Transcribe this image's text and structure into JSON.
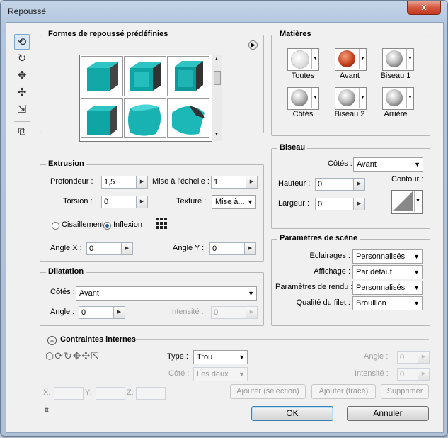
{
  "window": {
    "title": "Repoussé",
    "close_label": "x"
  },
  "tools": [
    "rotate-object-tool",
    "roll-object-tool",
    "drag-object-tool",
    "slide-object-tool",
    "scale-object-tool",
    "camera-icon"
  ],
  "presets": {
    "title": "Formes de repoussé prédéfinies",
    "menu_arrow": "▶"
  },
  "extrusion": {
    "title": "Extrusion",
    "depth_label": "Profondeur :",
    "depth_value": "1,5",
    "scale_label": "Mise à l'échelle :",
    "scale_value": "1",
    "twist_label": "Torsion :",
    "twist_value": "0",
    "texture_label": "Texture :",
    "texture_value": "Mise à...",
    "shear_label": "Cisaillement",
    "bend_label": "Inflexion",
    "anglex_label": "Angle X :",
    "anglex_value": "0",
    "angley_label": "Angle Y :",
    "angley_value": "0"
  },
  "inflation": {
    "title": "Dilatation",
    "sides_label": "Côtés :",
    "sides_value": "Avant",
    "angle_label": "Angle :",
    "angle_value": "0",
    "intensity_label": "Intensité :",
    "intensity_value": "0"
  },
  "materials": {
    "title": "Matières",
    "items": [
      {
        "label": "Toutes"
      },
      {
        "label": "Avant"
      },
      {
        "label": "Biseau 1"
      },
      {
        "label": "Côtés"
      },
      {
        "label": "Biseau 2"
      },
      {
        "label": "Arrière"
      }
    ]
  },
  "bevel": {
    "title": "Biseau",
    "sides_label": "Côtés :",
    "sides_value": "Avant",
    "height_label": "Hauteur :",
    "height_value": "0",
    "width_label": "Largeur :",
    "width_value": "0",
    "contour_label": "Contour :"
  },
  "scene": {
    "title": "Paramètres de scène",
    "lights_label": "Eclairages :",
    "lights_value": "Personnalisés",
    "view_label": "Affichage :",
    "view_value": "Par défaut",
    "render_label": "Paramètres de rendu :",
    "render_value": "Personnalisés",
    "mesh_label": "Qualité du filet :",
    "mesh_value": "Brouillon"
  },
  "constraints": {
    "title": "Contraintes internes",
    "type_label": "Type :",
    "type_value": "Trou",
    "side_label": "Côté :",
    "side_value": "Les deux",
    "angle_label": "Angle :",
    "angle_value": "0",
    "intensity_label": "Intensité :",
    "intensity_value": "0",
    "x_label": "X:",
    "y_label": "Y:",
    "z_label": "Z:",
    "add_selection": "Ajouter (sélection)",
    "add_path": "Ajouter (tracé)",
    "delete": "Supprimer"
  },
  "footer": {
    "ok": "OK",
    "cancel": "Annuler"
  }
}
